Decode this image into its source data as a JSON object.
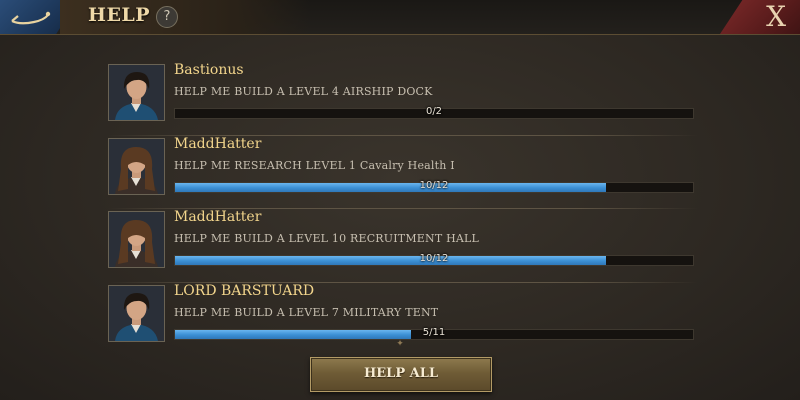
{
  "header": {
    "title": "HELP",
    "help_icon_glyph": "?",
    "close_glyph": "X"
  },
  "requests": [
    {
      "name": "Bastionus",
      "task": "HELP ME BUILD A LEVEL 4 AIRSHIP DOCK",
      "progress_text": "0/2",
      "progress": 0.0,
      "avatar": "portrait-dark-haired-man"
    },
    {
      "name": "MaddHatter",
      "task": "HELP ME RESEARCH LEVEL 1 Cavalry Health I",
      "progress_text": "10/12",
      "progress": 0.833,
      "avatar": "portrait-long-haired-man"
    },
    {
      "name": "MaddHatter",
      "task": "HELP ME BUILD A LEVEL 10 RECRUITMENT HALL",
      "progress_text": "10/12",
      "progress": 0.833,
      "avatar": "portrait-long-haired-man"
    },
    {
      "name": "LORD BARSTUARD",
      "task": "HELP ME BUILD A LEVEL 7 MILITARY TENT",
      "progress_text": "5/11",
      "progress": 0.455,
      "avatar": "portrait-dark-haired-man"
    }
  ],
  "footer": {
    "help_all_label": "HELP ALL"
  },
  "colors": {
    "name_gold": "#f2d58c",
    "progress_blue": "#3b8fd4",
    "close_red": "#7d2a2a",
    "back_blue": "#2b4d78"
  }
}
